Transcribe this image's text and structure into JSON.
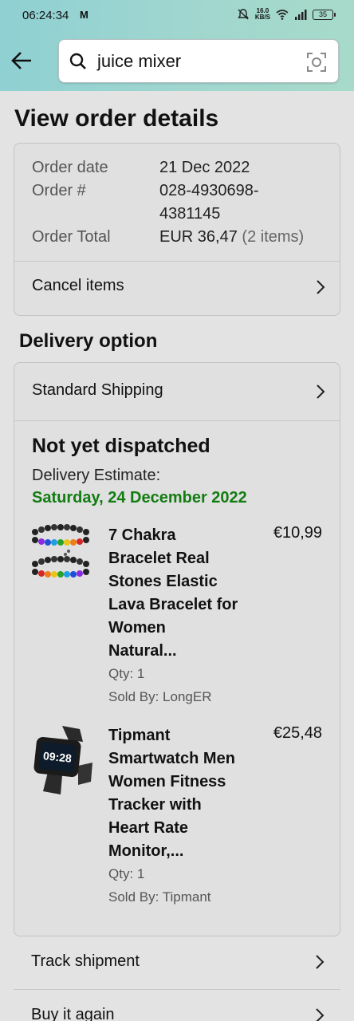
{
  "status_bar": {
    "time": "06:24:34",
    "mail_icon": "M",
    "speed_value": "16.0",
    "speed_unit": "KB/S",
    "battery": "35"
  },
  "search": {
    "query": "juice mixer"
  },
  "page": {
    "title": "View order details"
  },
  "order": {
    "date_label": "Order date",
    "date_value": "21 Dec 2022",
    "number_label": "Order #",
    "number_line1": "028-4930698-",
    "number_line2": "4381145",
    "total_label": "Order Total",
    "total_value": "EUR 36,47",
    "total_items": "(2 items)",
    "cancel_label": "Cancel items"
  },
  "delivery": {
    "section_title": "Delivery option",
    "shipping_label": "Standard Shipping",
    "status": "Not yet dispatched",
    "estimate_label": "Delivery Estimate:",
    "estimate_date": "Saturday, 24 December 2022",
    "estimate_color": "#127c11"
  },
  "items": [
    {
      "name_lines": [
        "7 Chakra",
        "Bracelet Real",
        "Stones Elastic",
        "Lava Bracelet for",
        "Women",
        "Natural..."
      ],
      "price": "€10,99",
      "qty": "Qty: 1",
      "seller": "Sold By: LongER",
      "icon": "bracelet-image"
    },
    {
      "name_lines": [
        "Tipmant",
        "Smartwatch Men",
        "Women Fitness",
        "Tracker with",
        "Heart Rate",
        "Monitor,..."
      ],
      "price": "€25,48",
      "qty": "Qty: 1",
      "seller": "Sold By: Tipmant",
      "icon": "smartwatch-image",
      "watch_time": "09:28"
    }
  ],
  "actions": {
    "track": "Track shipment",
    "buy_again": "Buy it again"
  }
}
